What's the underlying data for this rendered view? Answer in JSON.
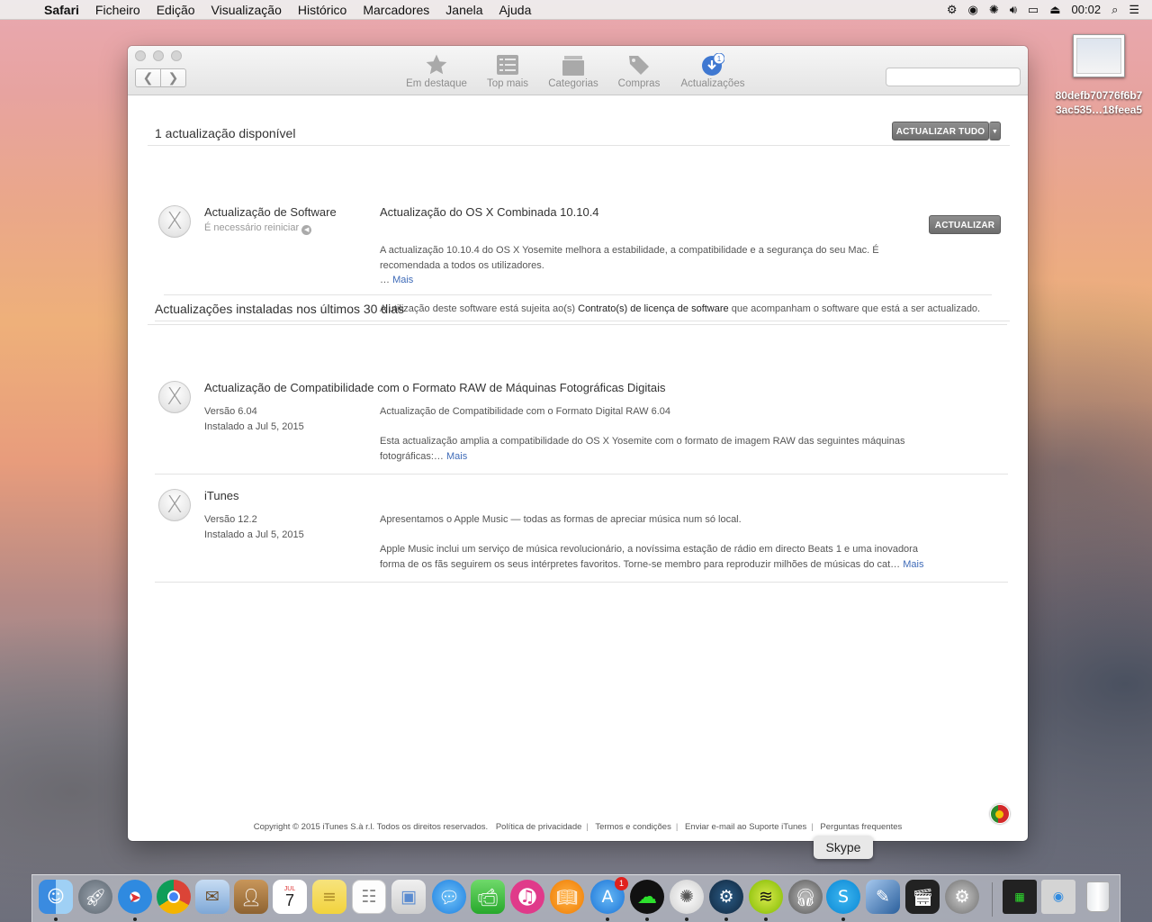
{
  "menubar": {
    "app": "Safari",
    "items": [
      "Ficheiro",
      "Edição",
      "Visualização",
      "Histórico",
      "Marcadores",
      "Janela",
      "Ajuda"
    ],
    "clock": "00:02"
  },
  "desktop_file": {
    "name_line1": "80defb70776f6b7",
    "name_line2": "3ac535…18feea5"
  },
  "toolbar": {
    "tabs": [
      "Em destaque",
      "Top mais",
      "Categorias",
      "Compras",
      "Actualizações"
    ],
    "updates_badge": "1",
    "search_placeholder": ""
  },
  "available": {
    "title": "1 actualização disponível",
    "update_all_label": "ACTUALIZAR TUDO",
    "item": {
      "name": "Actualização de Software",
      "restart_note": "É necessário reiniciar",
      "title": "Actualização do OS X Combinada 10.10.4",
      "update_label": "ACTUALIZAR",
      "desc_line1": "A actualização 10.10.4 do OS X Yosemite melhora a estabilidade, a compatibilidade e a segurança do seu Mac. É",
      "desc_line2": "recomendada a todos os utilizadores.",
      "ellipsis": "…",
      "more": "Mais",
      "license_pre": "A utilização deste software está sujeita ao(s)",
      "license_link": "Contrato(s) de licença de software",
      "license_post": "que acompanham o software que está a ser actualizado."
    }
  },
  "installed": {
    "title": "Actualizações instaladas nos últimos 30 dias",
    "items": [
      {
        "name": "Actualização de Compatibilidade com o Formato RAW de Máquinas Fotográficas Digitais",
        "version": "Versão 6.04",
        "installed": "Instalado a Jul 5, 2015",
        "subtitle": "Actualização de Compatibilidade com o Formato Digital RAW 6.04",
        "desc_line1": "Esta actualização amplia a compatibilidade do OS X Yosemite com o formato de imagem RAW das seguintes máquinas",
        "desc_line2": "fotográficas:…",
        "more": "Mais"
      },
      {
        "name": "iTunes",
        "version": "Versão 12.2",
        "installed": "Instalado a Jul 5, 2015",
        "subtitle": "Apresentamos o Apple Music — todas as formas de apreciar música num só local.",
        "desc_line1": "Apple Music inclui um serviço de música revolucionário, a novíssima estação de rádio em directo Beats 1 e uma inovadora",
        "desc_line2": "forma de os fãs seguirem os seus intérpretes favoritos. Torne-se membro para reproduzir milhões de músicas do cat…",
        "more": "Mais"
      }
    ]
  },
  "footer": {
    "copyright": "Copyright © 2015 iTunes S.à r.l. Todos os direitos reservados.",
    "links": [
      "Política de privacidade",
      "Termos e condições",
      "Enviar e-mail ao Suporte iTunes",
      "Perguntas frequentes"
    ]
  },
  "dock": {
    "tooltip": "Skype",
    "calendar_month": "JUL",
    "calendar_day": "7",
    "appstore_badge": "1"
  }
}
